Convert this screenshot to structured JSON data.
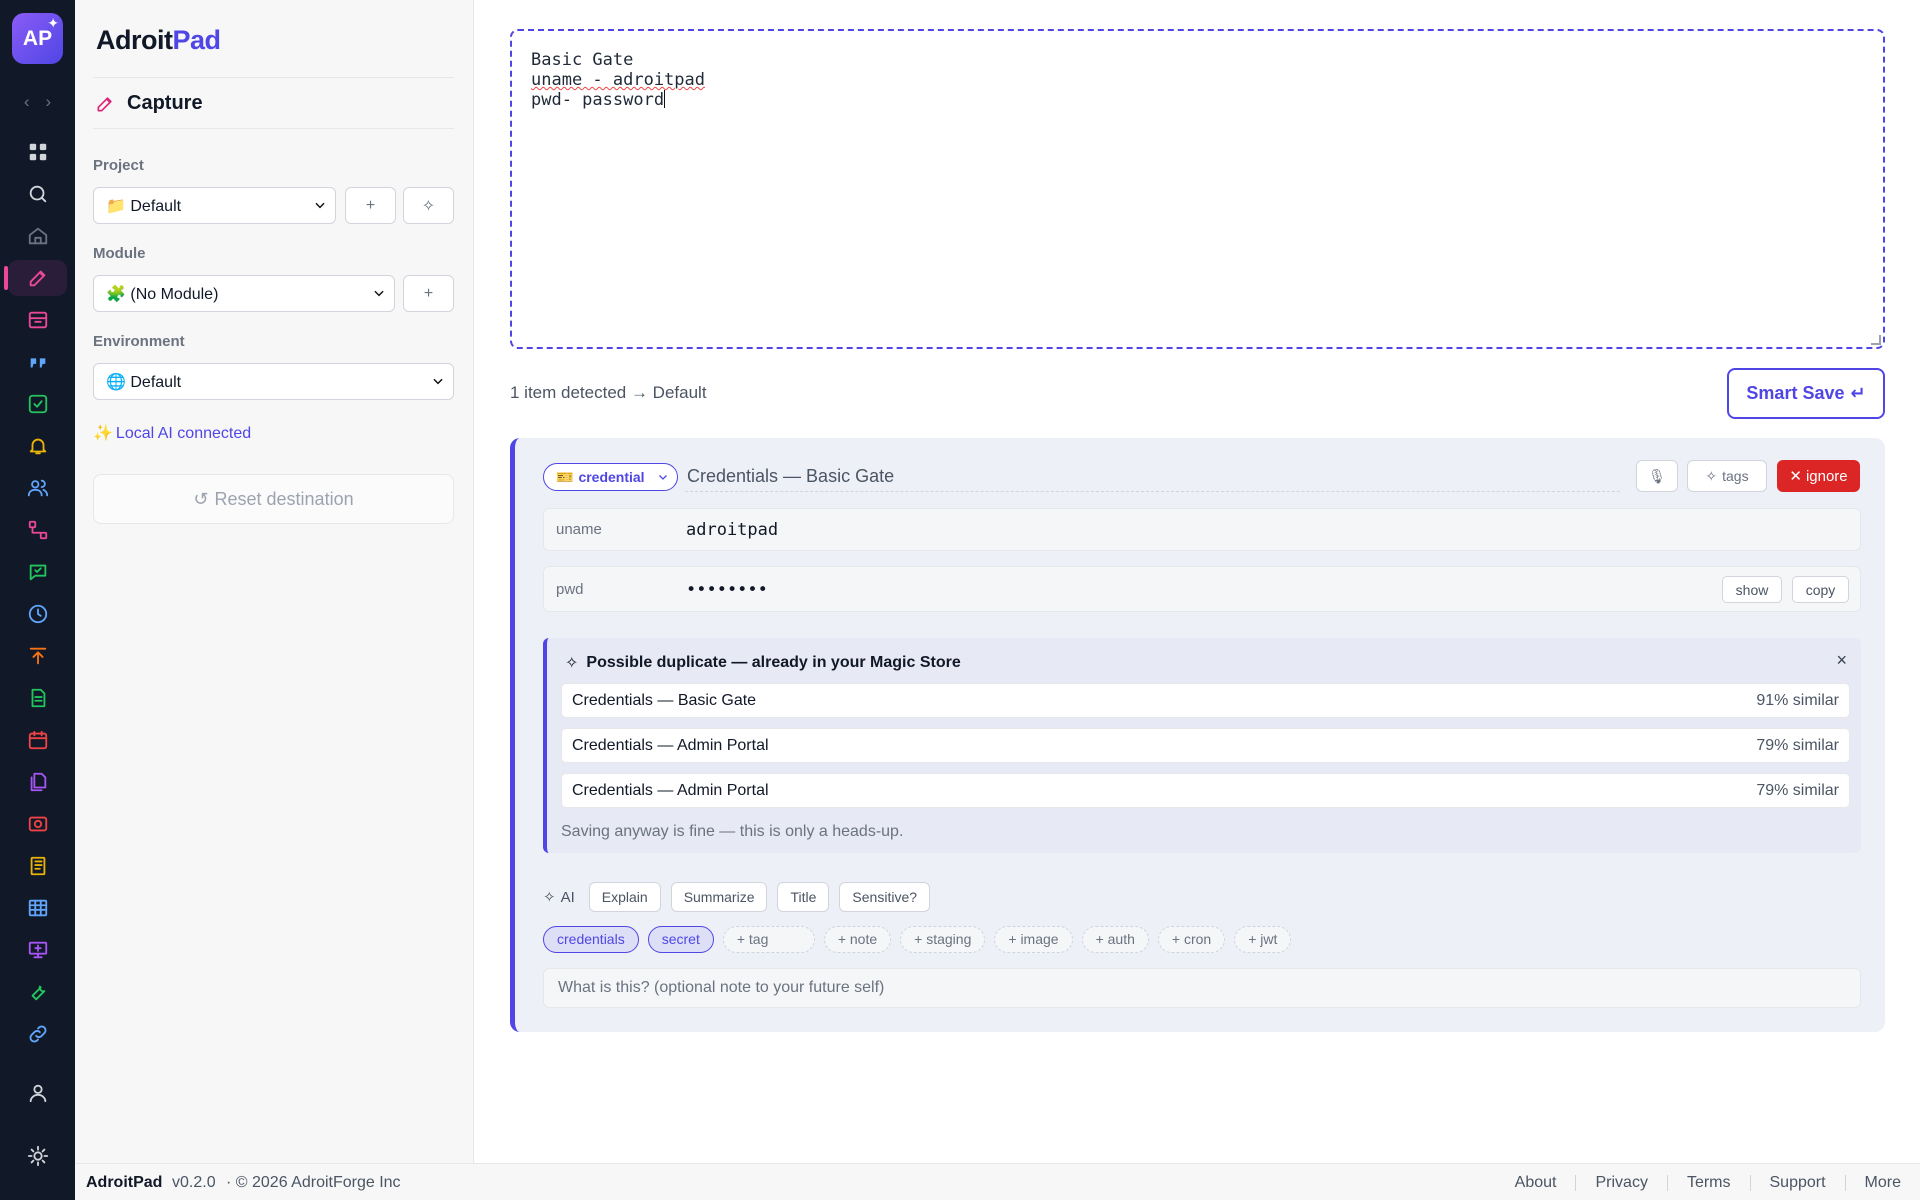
{
  "app": {
    "logo_text": "AP",
    "brand_first": "Adroit",
    "brand_second": "Pad"
  },
  "rail": {
    "icons": [
      "grid-icon",
      "search-icon",
      "home-icon",
      "pencil-icon",
      "inbox-icon",
      "quote-icon",
      "checkbox-icon",
      "bell-icon",
      "users-icon",
      "flow-icon",
      "chat-icon",
      "clock-icon",
      "upload-icon",
      "document-icon",
      "calendar-icon",
      "files-icon",
      "camera-icon",
      "notebook-icon",
      "table-icon",
      "presentation-icon",
      "wrench-icon",
      "link-icon",
      "user-icon",
      "sun-icon"
    ],
    "active": "pencil-icon",
    "accent": "#ec4899"
  },
  "panel": {
    "title": "Capture",
    "project": {
      "label": "Project",
      "value": "📁 Default",
      "add": "+",
      "magic": "✧"
    },
    "module": {
      "label": "Module",
      "value": "🧩 (No Module)",
      "add": "+"
    },
    "environment": {
      "label": "Environment",
      "value": "🌐 Default"
    },
    "ai_status": "Local AI connected",
    "ai_status_icon": "✨",
    "reset": "Reset destination",
    "reset_icon": "↺"
  },
  "editor": {
    "lines": [
      "Basic Gate",
      "uname - adroitpad",
      "pwd- password"
    ]
  },
  "status": {
    "detected": "1 item detected → Default"
  },
  "smart_save": {
    "label": "Smart Save",
    "icon": "↵"
  },
  "card": {
    "type": "credential",
    "type_icon": "🎫",
    "title": "Credentials — Basic Gate",
    "mic_icon": "🎙",
    "tags_label": "tags",
    "ignore_label": "ignore",
    "fields": [
      {
        "key": "uname",
        "value": "adroitpad"
      },
      {
        "key": "pwd",
        "value": "••••••••",
        "show": "show",
        "copy": "copy"
      }
    ],
    "duplicate": {
      "heading": "Possible duplicate — already in your Magic Store",
      "close": "×",
      "items": [
        {
          "title": "Credentials — Basic Gate",
          "similarity": "91% similar"
        },
        {
          "title": "Credentials — Admin Portal",
          "similarity": "79% similar"
        },
        {
          "title": "Credentials — Admin Portal",
          "similarity": "79% similar"
        }
      ],
      "note": "Saving anyway is fine — this is only a heads-up."
    },
    "ai": {
      "label": "AI",
      "actions": [
        "Explain",
        "Summarize",
        "Title",
        "Sensitive?"
      ]
    },
    "tags": {
      "active": [
        "credentials",
        "secret"
      ],
      "suggestions": [
        "+ tag",
        "+ note",
        "+ staging",
        "+ image",
        "+ auth",
        "+ cron",
        "+ jwt"
      ]
    },
    "note_placeholder": "What is this? (optional note to your future self)"
  },
  "footer": {
    "app": "AdroitPad",
    "version": "v0.2.0",
    "copyright": "· © 2026 AdroitForge Inc",
    "links": [
      "About",
      "Privacy",
      "Terms",
      "Support",
      "More"
    ]
  },
  "colors": {
    "accent": "#4f46e5",
    "danger": "#dc2626",
    "rail_bg": "#111827"
  }
}
